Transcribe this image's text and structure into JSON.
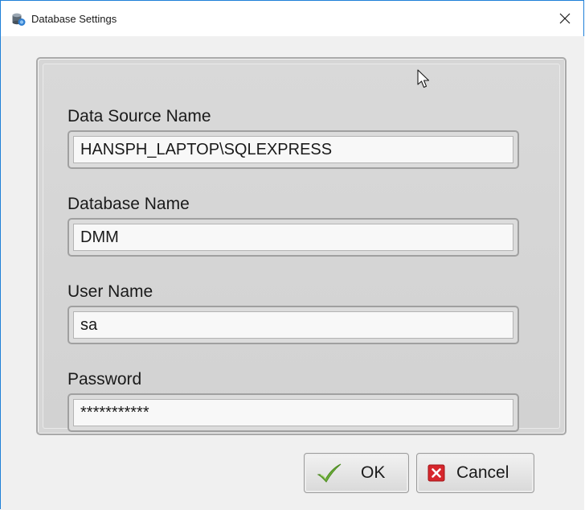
{
  "window": {
    "title": "Database Settings",
    "icons": {
      "app": "database-icon",
      "close": "close-icon"
    }
  },
  "form": {
    "fields": [
      {
        "label": "Data Source Name",
        "value": "HANSPH_LAPTOP\\SQLEXPRESS"
      },
      {
        "label": "Database Name",
        "value": "DMM"
      },
      {
        "label": "User Name",
        "value": "sa"
      },
      {
        "label": "Password",
        "value": "***********"
      }
    ]
  },
  "buttons": {
    "ok": {
      "label": "OK",
      "icon": "checkmark-icon"
    },
    "cancel": {
      "label": "Cancel",
      "icon": "cancel-x-icon"
    }
  },
  "colors": {
    "title_border": "#1f80d8",
    "ok_check": "#6fb33a",
    "cancel_red": "#d7262c"
  }
}
